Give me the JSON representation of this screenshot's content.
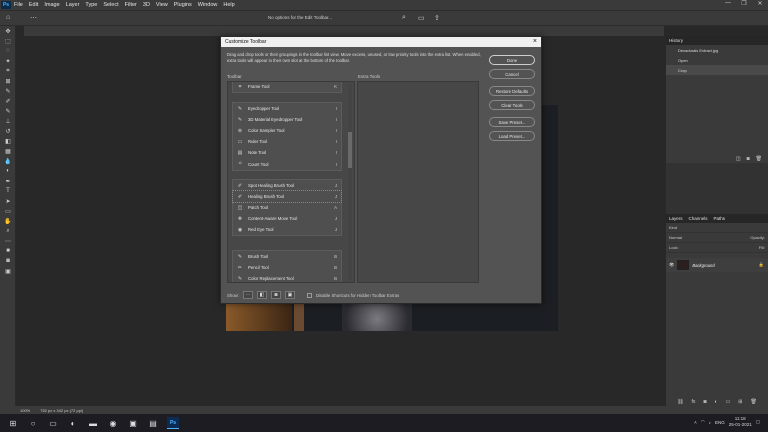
{
  "menubar": {
    "logo": "Ps",
    "items": [
      "File",
      "Edit",
      "Image",
      "Layer",
      "Type",
      "Select",
      "Filter",
      "3D",
      "View",
      "Plugins",
      "Window",
      "Help"
    ],
    "win": [
      "—",
      "❐",
      "✕"
    ]
  },
  "options_bar": {
    "message": "No options for the Edit Toolbar..."
  },
  "history_panel": {
    "title": "History",
    "document": "Decadurals Extract.jpg",
    "items": [
      "Open",
      "Crop"
    ]
  },
  "layers_panel": {
    "tabs": [
      "Layers",
      "Channels",
      "Paths"
    ],
    "kind": "Kind",
    "blend": "Normal",
    "opacity_label": "Opacity:",
    "lock_label": "Lock:",
    "fill_label": "Fill:",
    "layer_name": "Background"
  },
  "statusbar": {
    "zoom": "100%",
    "info": "752 px x 342 px (72 ppi)"
  },
  "taskbar": {
    "lang": "ENG",
    "time": "11:18",
    "date": "25-01-2021"
  },
  "dialog": {
    "title": "Customize Toolbar",
    "description": "Drag and drop tools or their groupings in the toolbar list view. Move excess, unused, or low priority tools into the extra list. When enabled, extra tools will appear in their own slot at the bottom of the toolbar.",
    "toolbar_label": "Toolbar",
    "extra_label": "Extra Tools",
    "groups": [
      {
        "items": [
          {
            "icon": "⌗",
            "name": "Frame Tool",
            "key": "K"
          }
        ]
      },
      {
        "items": [
          {
            "icon": "✎",
            "name": "Eyedropper Tool",
            "key": "I"
          },
          {
            "icon": "✎",
            "name": "3D Material Eyedropper Tool",
            "key": "I"
          },
          {
            "icon": "⊕",
            "name": "Color Sampler Tool",
            "key": "I"
          },
          {
            "icon": "▭",
            "name": "Ruler Tool",
            "key": "I"
          },
          {
            "icon": "▤",
            "name": "Note Tool",
            "key": "I"
          },
          {
            "icon": "¹²",
            "name": "Count Tool",
            "key": "I"
          }
        ]
      },
      {
        "items": [
          {
            "icon": "✐",
            "name": "Spot Healing Brush Tool",
            "key": "J"
          },
          {
            "icon": "✐",
            "name": "Healing Brush Tool",
            "key": "J"
          },
          {
            "icon": "◫",
            "name": "Patch Tool",
            "key": "A"
          },
          {
            "icon": "✥",
            "name": "Content-Aware Move Tool",
            "key": "J"
          },
          {
            "icon": "◉",
            "name": "Red Eye Tool",
            "key": "J"
          }
        ]
      },
      {
        "items": [
          {
            "icon": "✎",
            "name": "Brush Tool",
            "key": "B"
          },
          {
            "icon": "✏",
            "name": "Pencil Tool",
            "key": "B"
          },
          {
            "icon": "✎",
            "name": "Color Replacement Tool",
            "key": "B"
          }
        ]
      }
    ],
    "buttons": {
      "done": "Done",
      "cancel": "Cancel",
      "restore": "Restore Defaults",
      "clear": "Clear Tools",
      "save": "Save Preset...",
      "load": "Load Preset..."
    },
    "show_label": "Show:",
    "disable_shortcuts": "Disable Shortcuts for Hidden Toolbar Extras"
  }
}
